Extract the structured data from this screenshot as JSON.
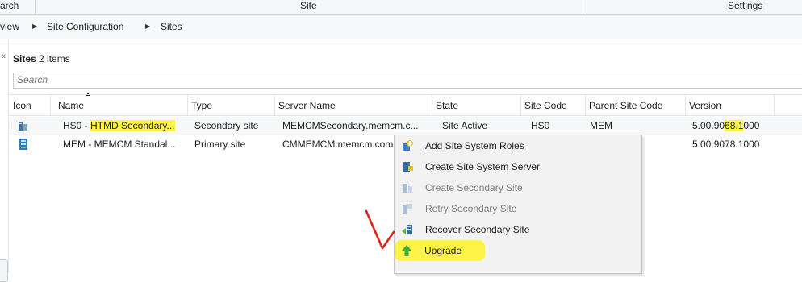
{
  "ribbon": {
    "groups": [
      "arch",
      "Site",
      "Settings"
    ]
  },
  "breadcrumb": {
    "items": [
      "view",
      "Site Configuration",
      "Sites"
    ]
  },
  "list": {
    "title": "Sites",
    "count_text": "2 items",
    "search_placeholder": "Search"
  },
  "columns": [
    "Icon",
    "Name",
    "Type",
    "Server Name",
    "State",
    "Site Code",
    "Parent Site Code",
    "Version"
  ],
  "rows": [
    {
      "name_prefix": "HS0 - ",
      "name_highlight": "HTMD Secondary...",
      "type": "Secondary site",
      "server": "MEMCMSecondary.memcm.c...",
      "state": "Site Active",
      "site_code": "HS0",
      "parent": "MEM",
      "version_a": "5.00.90",
      "version_hl": "68.1",
      "version_b": "000"
    },
    {
      "name": "MEM - MEMCM Standal...",
      "type": "Primary site",
      "server": "CMMEMCM.memcm.com",
      "version": "5.00.9078.1000"
    }
  ],
  "context_menu": {
    "items": [
      {
        "label": "Add Site System Roles",
        "icon": "add-roles-icon",
        "enabled": true
      },
      {
        "label": "Create Site System Server",
        "icon": "server-icon",
        "enabled": true
      },
      {
        "label": "Create Secondary Site",
        "icon": "secondary-site-icon",
        "enabled": false
      },
      {
        "label": "Retry Secondary Site",
        "icon": "retry-icon",
        "enabled": false
      },
      {
        "label": "Recover Secondary Site",
        "icon": "recover-icon",
        "enabled": true
      },
      {
        "label": "Upgrade",
        "icon": "upgrade-arrow-icon",
        "enabled": true
      }
    ]
  },
  "colors": {
    "highlight": "#fff34a",
    "annotation": "#e0231a"
  }
}
